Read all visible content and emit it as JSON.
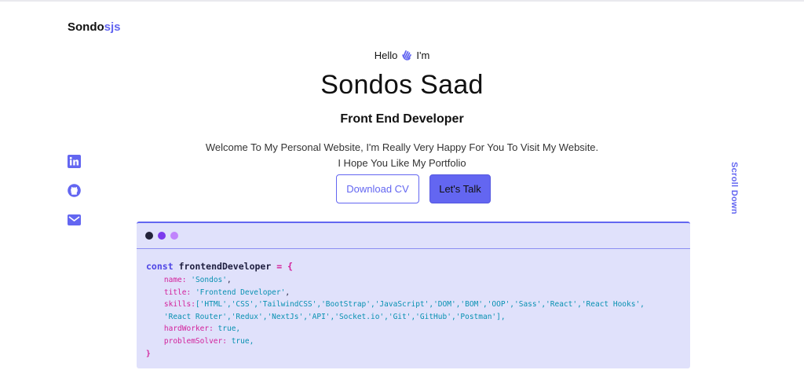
{
  "brand": {
    "prefix": "Sondo",
    "suffix": "sjs"
  },
  "hero": {
    "hello": "Hello",
    "im": "I'm",
    "name": "Sondos Saad",
    "role": "Front End Developer",
    "desc_line1": "Welcome To My Personal Website, I'm Really Very Happy For You To Visit My Website.",
    "desc_line2": "I Hope You Like My Portfolio"
  },
  "buttons": {
    "download": "Download CV",
    "talk": "Let's Talk"
  },
  "social": [
    {
      "icon": "linkedin-icon"
    },
    {
      "icon": "github-icon"
    },
    {
      "icon": "mail-icon"
    }
  ],
  "scroll_down": "Scroll Down",
  "colors": {
    "accent": "#6366f1",
    "card_bg": "#e0e1fb",
    "dot1": "#23233a",
    "dot2": "#7c3aed",
    "dot3": "#c084fc"
  },
  "code": {
    "keyword": "const",
    "variable": "frontendDeveloper",
    "op": "= {",
    "name_key": "name:",
    "name_val": "'Sondos'",
    "title_key": "title:",
    "title_val": "'Frontend Developer'",
    "skills_key": "skills:",
    "skills_line1": "['HTML','CSS','TailwindCSS','BootStrap','JavaScript','DOM','BOM','OOP','Sass','React','React Hooks',",
    "skills_line2": "'React Router','Redux','NextJs','API','Socket.io','Git','GitHub','Postman'],",
    "hard_key": "hardWorker:",
    "hard_val": "true,",
    "prob_key": "problemSolver:",
    "prob_val": "true,",
    "close": "}"
  }
}
